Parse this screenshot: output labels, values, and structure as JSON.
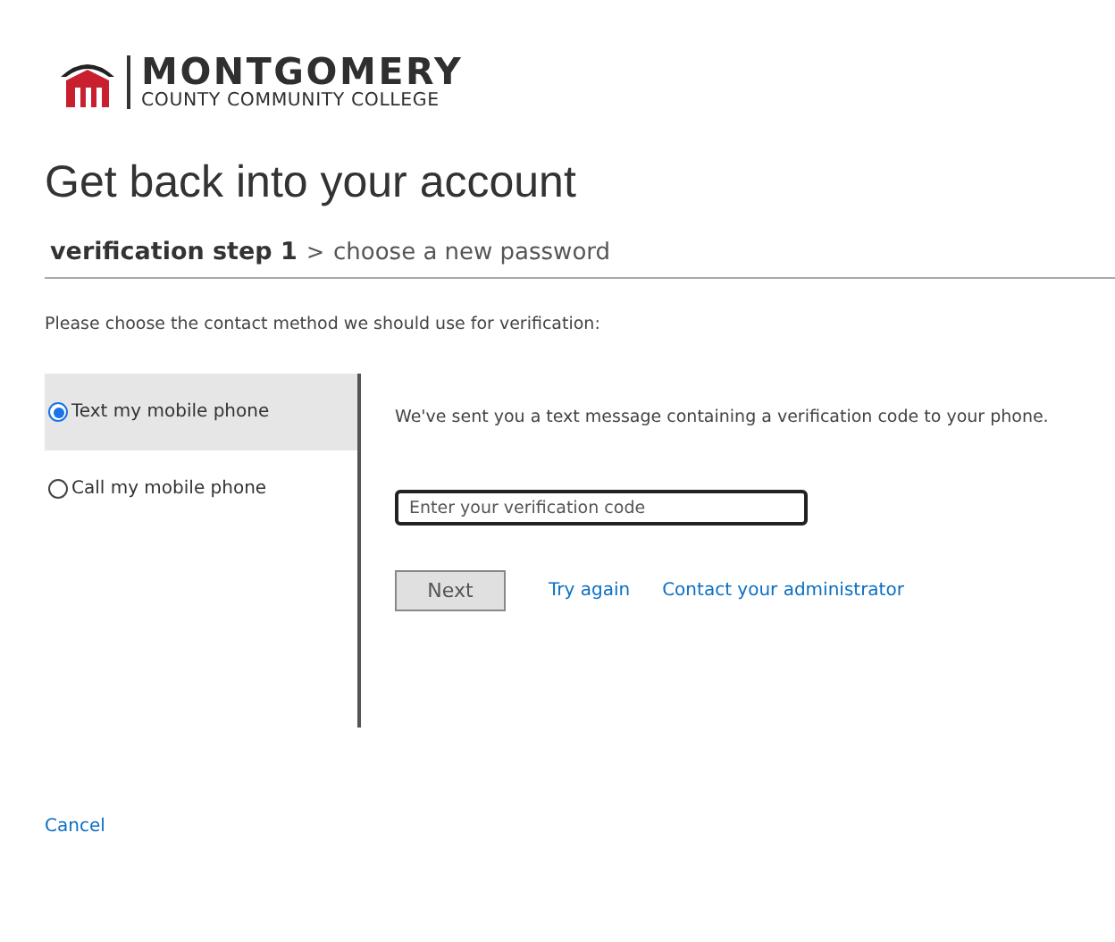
{
  "logo": {
    "name": "MONTGOMERY",
    "subtitle": "COUNTY COMMUNITY COLLEGE"
  },
  "title": "Get back into your account",
  "breadcrumb": {
    "separator": ">",
    "steps": [
      {
        "label": "verification step 1",
        "current": true
      },
      {
        "label": "choose a new password",
        "current": false
      }
    ]
  },
  "instruction": "Please choose the contact method we should use for verification:",
  "methods": [
    {
      "label": "Text my mobile phone",
      "selected": true
    },
    {
      "label": "Call my mobile phone",
      "selected": false
    }
  ],
  "message": "We've sent you a text message containing a verification code to your phone.",
  "code_field": {
    "placeholder": "Enter your verification code"
  },
  "next_button": {
    "label": "Next",
    "disabled": true
  },
  "links": [
    "Try again",
    "Contact your administrator"
  ],
  "cancel": "Cancel"
}
